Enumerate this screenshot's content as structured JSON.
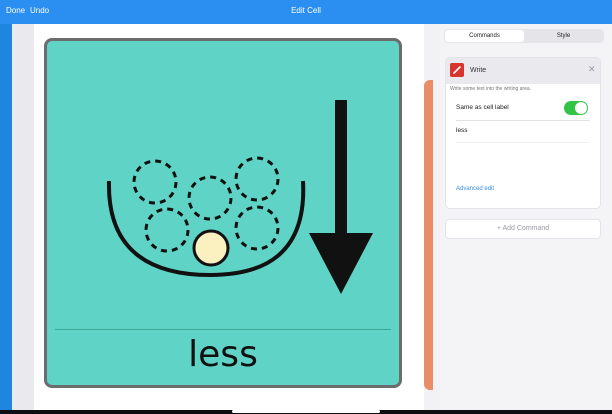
{
  "topbar": {
    "done_label": "Done",
    "undo_label": "Undo",
    "title": "Edit Cell"
  },
  "cell": {
    "label": "less",
    "background": "#5fd3c5",
    "symbol": "less-symbol"
  },
  "inspector": {
    "tabs": [
      {
        "label": "Commands",
        "active": true
      },
      {
        "label": "Style",
        "active": false
      }
    ],
    "command": {
      "icon": "pencil-icon",
      "title": "Write",
      "description": "Write some text into the writing area.",
      "toggle_label": "Same as cell label",
      "toggle_on": true,
      "text_value": "less",
      "advanced_label": "Advanced edit"
    },
    "add_command_label": "+ Add Command"
  },
  "colors": {
    "topbar": "#2a8ff0",
    "accent_link": "#3a8ee8",
    "toggle_on": "#33c447",
    "command_icon": "#d8332d",
    "peek_card": "#e98d66"
  }
}
